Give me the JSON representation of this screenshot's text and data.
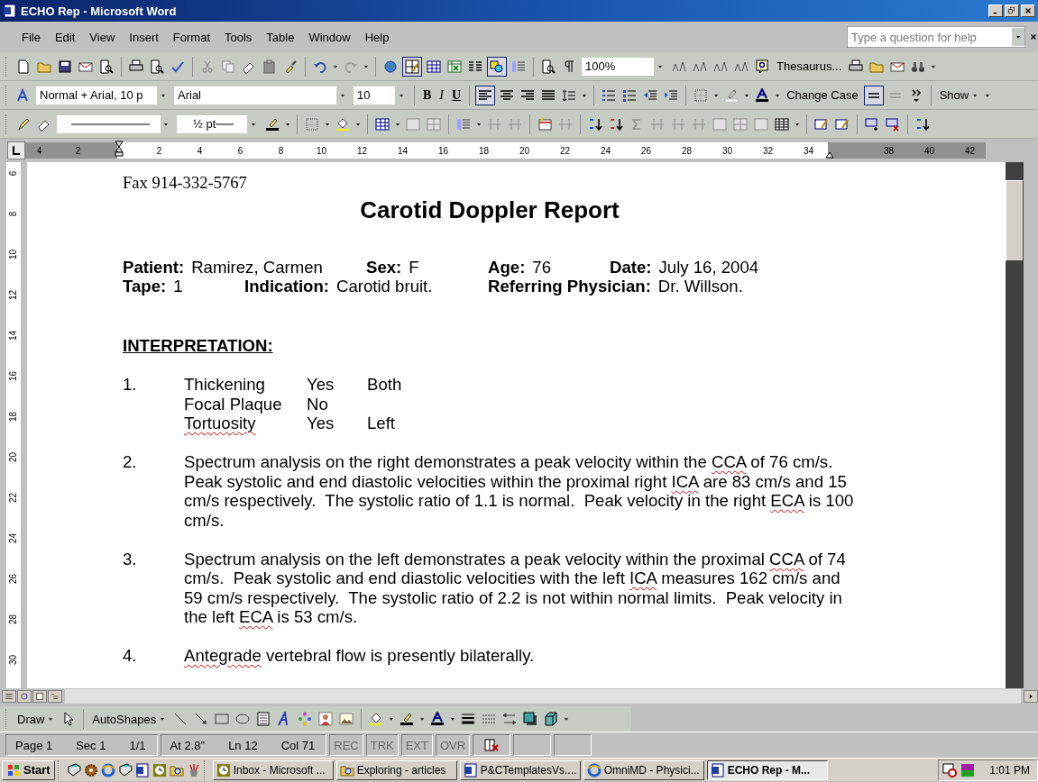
{
  "window": {
    "title": "ECHO Rep - Microsoft Word"
  },
  "menu": [
    {
      "label": "File"
    },
    {
      "label": "Edit"
    },
    {
      "label": "View"
    },
    {
      "label": "Insert"
    },
    {
      "label": "Format"
    },
    {
      "label": "Tools"
    },
    {
      "label": "Table"
    },
    {
      "label": "Window"
    },
    {
      "label": "Help"
    }
  ],
  "help_box": {
    "placeholder": "Type a question for help"
  },
  "standard_toolbar": {
    "zoom": "100%",
    "thesaurus": "Thesaurus...",
    "tables_and_borders_on": true,
    "drawing_on": true
  },
  "formatting_toolbar": {
    "style": "Normal + Arial, 10 p",
    "font": "Arial",
    "size": "10",
    "bold": "B",
    "italic": "I",
    "underline": "U",
    "align_left_on": true,
    "change_case": "Change Case",
    "line_style_on": true,
    "show": "Show"
  },
  "tables_borders_toolbar": {
    "line_weight": "½ pt"
  },
  "ruler": {
    "left_margin_labels": [
      "4",
      "2"
    ],
    "labels": [
      "2",
      "4",
      "6",
      "8",
      "10",
      "12",
      "14",
      "16",
      "18",
      "20",
      "22",
      "24",
      "26",
      "28",
      "30",
      "32",
      "34"
    ],
    "right_margin_labels": [
      "38",
      "40",
      "42"
    ]
  },
  "vertical_ruler": {
    "labels": [
      "6",
      "8",
      "10",
      "12",
      "14",
      "16",
      "18",
      "20",
      "22",
      "24",
      "26",
      "28",
      "30"
    ]
  },
  "document": {
    "fax": "Fax 914-332-5767",
    "title": "Carotid Doppler Report",
    "patient_rows": [
      [
        {
          "label": "Patient:",
          "value": "Ramirez, Carmen"
        },
        {
          "label": "Sex:",
          "value": "F"
        },
        {
          "label": "Age:",
          "value": "76"
        },
        {
          "label": "Date:",
          "value": "July 16, 2004"
        }
      ],
      [
        {
          "label": "Tape:",
          "value": "1"
        },
        {
          "label": "Indication:",
          "value": "Carotid bruit."
        },
        {
          "label": "Referring Physician:",
          "value": "Dr. Willson."
        }
      ]
    ],
    "section_heading": "INTERPRETATION:",
    "items": [
      {
        "number": "1.",
        "kind": "findings",
        "rows": [
          {
            "finding": {
              "text": "Thickening",
              "misspelled": false
            },
            "result": "Yes",
            "side": "Both"
          },
          {
            "finding": {
              "text": "Focal Plaque",
              "misspelled": false
            },
            "result": "No"
          },
          {
            "finding": {
              "text": "Tortuosity",
              "misspelled": true
            },
            "result": "Yes",
            "side": "Left"
          }
        ]
      },
      {
        "number": "2.",
        "kind": "paragraph",
        "segments": [
          {
            "text": "Spectrum analysis on the right demonstrates a peak velocity within the ",
            "misspelled": false
          },
          {
            "text": "CCA",
            "misspelled": true
          },
          {
            "text": " of 76 cm/s.  Peak systolic and end diastolic velocities within the proximal right ",
            "misspelled": false
          },
          {
            "text": "ICA",
            "misspelled": true
          },
          {
            "text": " are 83 cm/s and 15 cm/s respectively.  The systolic ratio of 1.1 is normal.  Peak velocity in the right ",
            "misspelled": false
          },
          {
            "text": "ECA",
            "misspelled": true
          },
          {
            "text": " is 100 cm/s.",
            "misspelled": false
          }
        ]
      },
      {
        "number": "3.",
        "kind": "paragraph",
        "segments": [
          {
            "text": "Spectrum analysis on the left demonstrates a peak velocity within the proximal ",
            "misspelled": false
          },
          {
            "text": "CCA",
            "misspelled": true
          },
          {
            "text": " of 74 cm/s.  Peak systolic and end diastolic velocities with the left ",
            "misspelled": false
          },
          {
            "text": "ICA",
            "misspelled": true
          },
          {
            "text": " measures 162 cm/s and 59 cm/s respectively.  The systolic ratio of 2.2 is not within normal limits.  Peak velocity in the left ",
            "misspelled": false
          },
          {
            "text": "ECA",
            "misspelled": true
          },
          {
            "text": " is 53 cm/s.",
            "misspelled": false
          }
        ]
      },
      {
        "number": "4.",
        "kind": "paragraph",
        "segments": [
          {
            "text": "Antegrade",
            "misspelled": true
          },
          {
            "text": " vertebral flow is presently bilaterally.",
            "misspelled": false
          }
        ]
      }
    ]
  },
  "drawing_toolbar": {
    "draw": "Draw",
    "autoshapes": "AutoShapes"
  },
  "status_bar": {
    "page": "Page 1",
    "section": "Sec 1",
    "pages": "1/1",
    "at": "At 2.8\"",
    "line": "Ln 12",
    "col": "Col 71",
    "modes": [
      {
        "label": "REC",
        "on": false
      },
      {
        "label": "TRK",
        "on": false
      },
      {
        "label": "EXT",
        "on": false
      },
      {
        "label": "OVR",
        "on": false
      }
    ]
  },
  "taskbar": {
    "start": "Start",
    "tasks": [
      {
        "label": "Inbox - Microsoft ...",
        "selected": false
      },
      {
        "label": "Exploring - articles",
        "selected": false
      },
      {
        "label": "P&CTemplatesVs....",
        "selected": false
      },
      {
        "label": "OmniMD - Physici...",
        "selected": false
      },
      {
        "label": "ECHO Rep - M...",
        "selected": true
      }
    ],
    "clock": "1:01 PM"
  }
}
